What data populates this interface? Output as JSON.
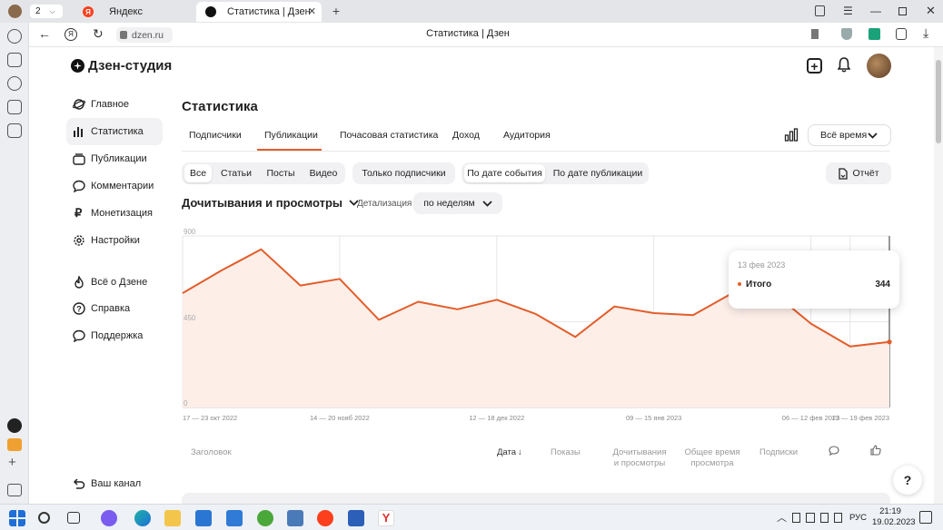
{
  "browser": {
    "tab_count": "2",
    "tabs": [
      {
        "label": "Яндекс"
      },
      {
        "label": "Статистика | Дзен"
      }
    ],
    "address": "dzen.ru",
    "page_title": "Статистика | Дзен"
  },
  "header": {
    "logo": "Дзен-студия"
  },
  "sidebar": {
    "items": [
      {
        "label": "Главное"
      },
      {
        "label": "Статистика"
      },
      {
        "label": "Публикации"
      },
      {
        "label": "Комментарии"
      },
      {
        "label": "Монетизация"
      },
      {
        "label": "Настройки"
      },
      {
        "label": "Всё о Дзене"
      },
      {
        "label": "Справка"
      },
      {
        "label": "Поддержка"
      }
    ],
    "channel_label": "Ваш канал"
  },
  "main": {
    "title": "Статистика",
    "tabs": [
      {
        "label": "Подписчики"
      },
      {
        "label": "Публикации"
      },
      {
        "label": "Почасовая статистика"
      },
      {
        "label": "Доход"
      },
      {
        "label": "Аудитория"
      }
    ],
    "period": "Всё время",
    "type_filters": [
      "Все",
      "Статьи",
      "Посты",
      "Видео"
    ],
    "subscribers_only": "Только подписчики",
    "date_filters": [
      "По дате события",
      "По дате публикации"
    ],
    "report_button": "Отчёт",
    "metric": "Дочитывания и просмотры",
    "detail_label": "Детализация",
    "detail_value": "по неделям",
    "columns": {
      "title": "Заголовок",
      "date": "Дата",
      "shows": "Показы",
      "reads_1": "Дочитывания",
      "reads_2": "и просмотры",
      "time_1": "Общее время",
      "time_2": "просмотра",
      "subs": "Подписки"
    }
  },
  "tooltip": {
    "date": "13 фев 2023",
    "label": "Итого",
    "value": "344"
  },
  "help_label": "?",
  "taskbar": {
    "lang": "РУС",
    "time": "21:19",
    "date": "19.02.2023"
  },
  "chart_data": {
    "type": "area",
    "ylim": [
      0,
      900
    ],
    "yticks": [
      "900",
      "450",
      "0"
    ],
    "x_labels": [
      "17 — 23 окт 2022",
      "14 — 20 нояб 2022",
      "12 — 18 дек 2022",
      "09 — 15 янв 2023",
      "06 — 12 фев 2023",
      "13 — 19 фев 2023"
    ],
    "accent": "#e35d2a",
    "values": [
      600,
      720,
      830,
      640,
      675,
      460,
      555,
      515,
      565,
      490,
      370,
      530,
      495,
      485,
      600,
      610,
      440,
      320,
      344
    ]
  }
}
